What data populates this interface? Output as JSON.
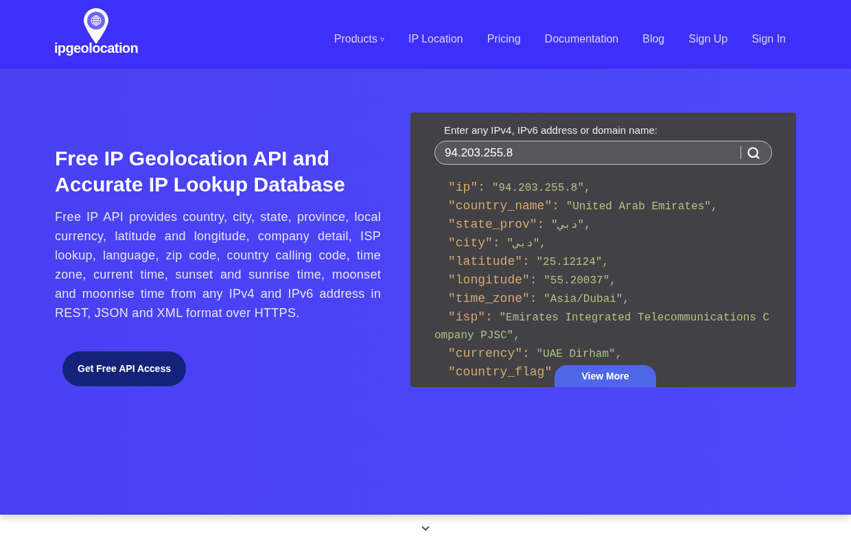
{
  "header": {
    "logo": {
      "text": "ipgeolocation"
    },
    "nav": [
      {
        "label": "Products",
        "caret": "▿"
      },
      {
        "label": "IP Location"
      },
      {
        "label": "Pricing"
      },
      {
        "label": "Documentation"
      },
      {
        "label": "Blog"
      },
      {
        "label": "Sign Up"
      },
      {
        "label": "Sign In"
      }
    ]
  },
  "hero": {
    "heading": "Free IP Geolocation API and Accurate IP Lookup Database",
    "description": "Free IP API provides country, city, state, province, local currency, latitude and longitude, company detail, ISP lookup, language, zip code, country calling code, time zone, current time, sunset and sunrise time, moonset and moonrise time from any IPv4 and IPv6 address in REST, JSON and XML format over HTTPS.",
    "cta": "Get Free API Access"
  },
  "lookup": {
    "label": "Enter any IPv4, IPv6 address or domain name:",
    "value": "94.203.255.8",
    "result": [
      {
        "key": "\"ip\":",
        "value": "\"94.203.255.8\","
      },
      {
        "key": "\"country_name\":",
        "value": "\"United Arab Emirates\","
      },
      {
        "key": "\"state_prov\":",
        "value": "\"دبي\","
      },
      {
        "key": "\"city\":",
        "value": "\"دبي\","
      },
      {
        "key": "\"latitude\":",
        "value": "\"25.12124\","
      },
      {
        "key": "\"longitude\":",
        "value": "\"55.20037\","
      },
      {
        "key": "\"time_zone\":",
        "value": "\"Asia/Dubai\","
      },
      {
        "key": "\"isp\":",
        "value": "\"Emirates Integrated Telecommunications Company PJSC\","
      },
      {
        "key": "\"currency\":",
        "value": "\"UAE Dirham\","
      },
      {
        "key": "\"country_flag\""
      }
    ],
    "more_button": "View More"
  }
}
